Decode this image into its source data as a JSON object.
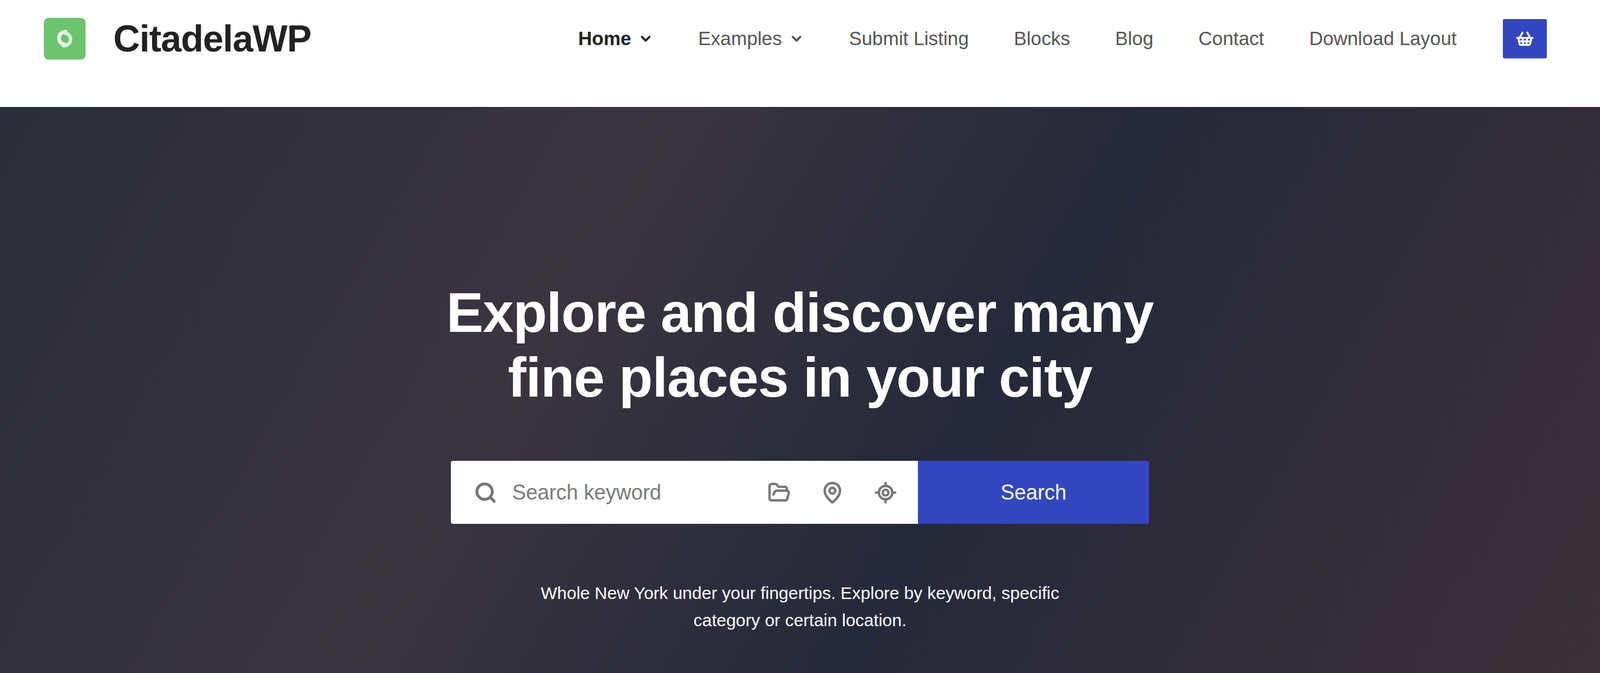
{
  "header": {
    "brand": "CitadelaWP",
    "nav": [
      {
        "label": "Home",
        "selected": true,
        "dropdown": true
      },
      {
        "label": "Examples",
        "selected": false,
        "dropdown": true
      },
      {
        "label": "Submit Listing",
        "selected": false,
        "dropdown": false
      },
      {
        "label": "Blocks",
        "selected": false,
        "dropdown": false
      },
      {
        "label": "Blog",
        "selected": false,
        "dropdown": false
      },
      {
        "label": "Contact",
        "selected": false,
        "dropdown": false
      },
      {
        "label": "Download Layout",
        "selected": false,
        "dropdown": false
      }
    ]
  },
  "hero": {
    "title_lines": [
      "Explore and discover many",
      "fine places in your city"
    ],
    "search": {
      "placeholder": "Search keyword",
      "button": "Search"
    },
    "subtitle_lines": [
      "Whole New York under your fingertips. Explore by keyword, specific",
      "category or certain location."
    ]
  }
}
